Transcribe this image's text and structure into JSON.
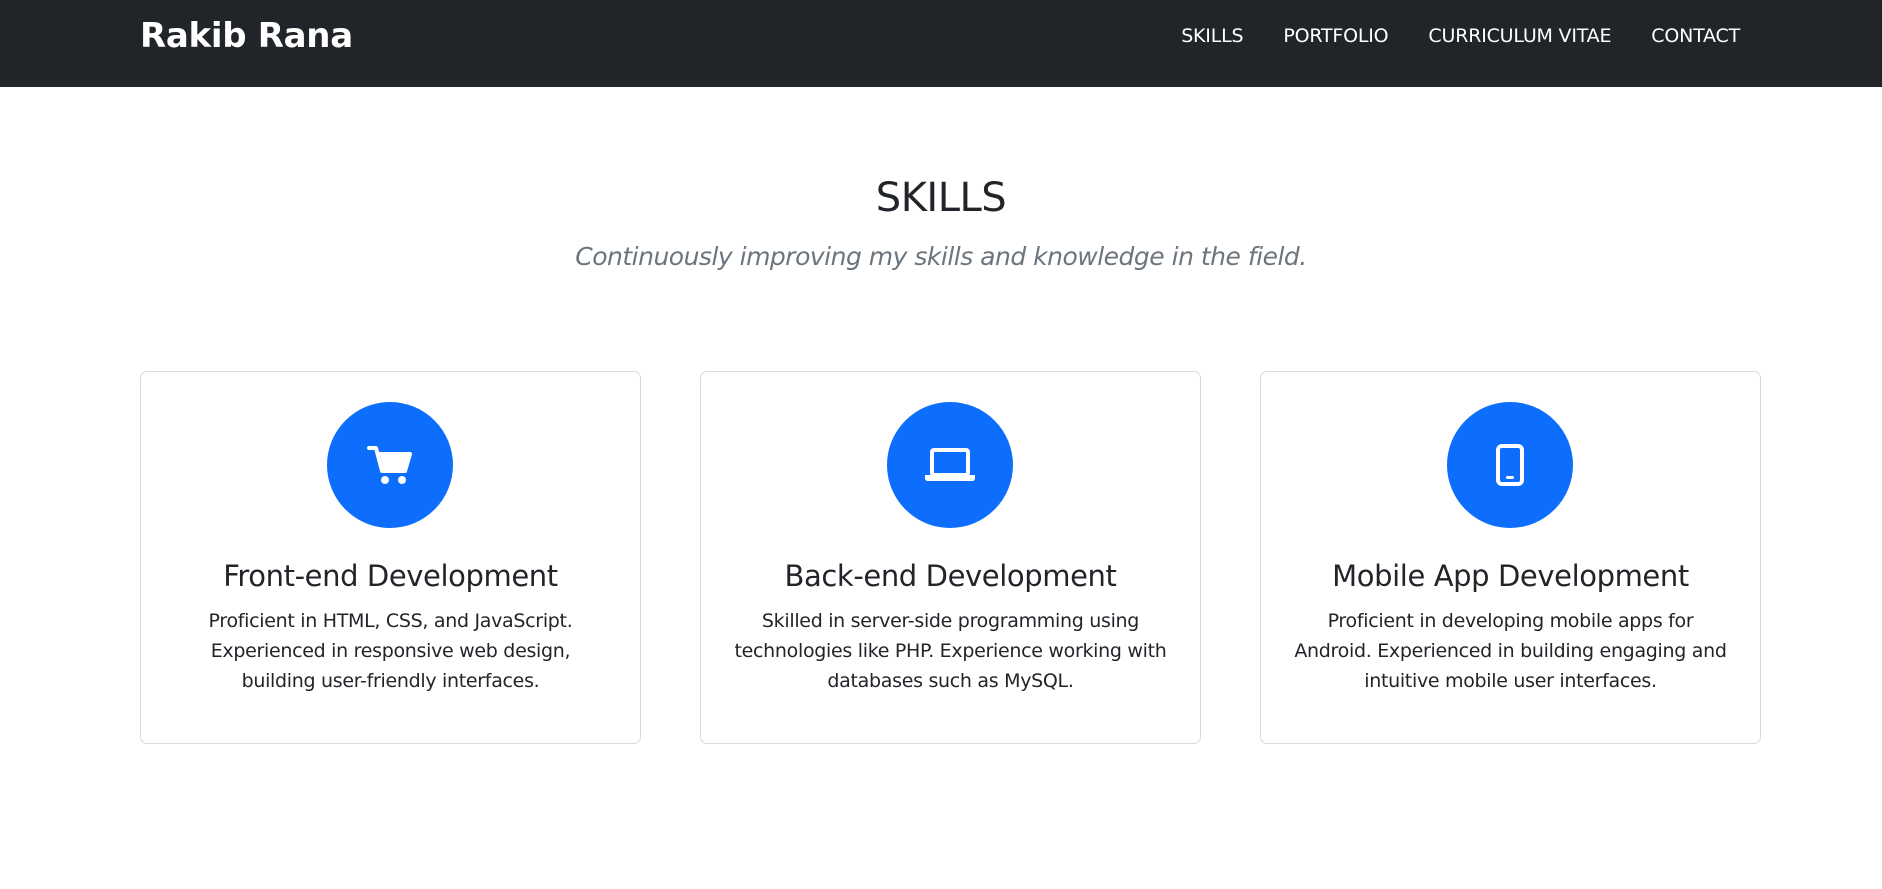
{
  "navbar": {
    "brand": "Rakib Rana",
    "links": [
      {
        "label": "SKILLS"
      },
      {
        "label": "PORTFOLIO"
      },
      {
        "label": "CURRICULUM VITAE"
      },
      {
        "label": "CONTACT"
      }
    ],
    "background_color": "#212529"
  },
  "section": {
    "title": "SKILLS",
    "subtitle": "Continuously improving my skills and knowledge in the field."
  },
  "cards": [
    {
      "icon": "shopping-cart-icon",
      "title": "Front-end Development",
      "text": "Proficient in HTML, CSS, and JavaScript. Experienced in responsive web design, building user-friendly interfaces."
    },
    {
      "icon": "laptop-icon",
      "title": "Back-end Development",
      "text": "Skilled in server-side programming using technologies like PHP. Experience working with databases such as MySQL."
    },
    {
      "icon": "mobile-phone-icon",
      "title": "Mobile App Development",
      "text": "Proficient in developing mobile apps for Android. Experienced in building engaging and intuitive mobile user interfaces."
    }
  ],
  "colors": {
    "accent": "#0d6efd",
    "muted_text": "#6c757d",
    "card_border": "#d8dadd"
  }
}
